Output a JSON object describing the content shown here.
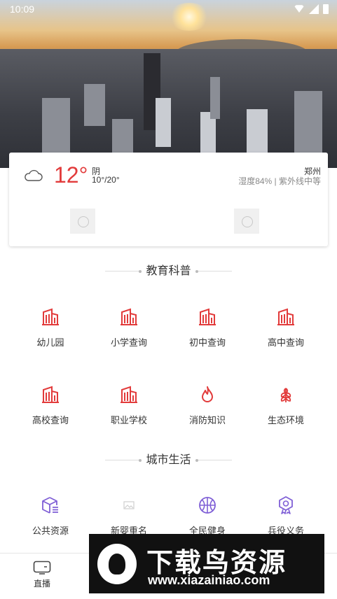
{
  "status_bar": {
    "time": "10:09"
  },
  "weather": {
    "temperature": "12°",
    "condition": "阴",
    "range": "10°/20°",
    "city": "郑州",
    "details": "湿度84% | 紫外线中等",
    "icon": "cloud-icon"
  },
  "sections": {
    "education": {
      "title": "教育科普",
      "items": [
        {
          "label": "幼儿园",
          "icon": "building-icon"
        },
        {
          "label": "小学查询",
          "icon": "building-icon"
        },
        {
          "label": "初中查询",
          "icon": "building-icon"
        },
        {
          "label": "高中查询",
          "icon": "building-icon"
        },
        {
          "label": "高校查询",
          "icon": "building-icon"
        },
        {
          "label": "职业学校",
          "icon": "building-icon"
        },
        {
          "label": "消防知识",
          "icon": "flame-icon"
        },
        {
          "label": "生态环境",
          "icon": "leaf-icon"
        }
      ]
    },
    "city_life": {
      "title": "城市生活",
      "items": [
        {
          "label": "公共资源",
          "icon": "cube-icon"
        },
        {
          "label": "新婴重名",
          "icon": "image-placeholder-icon"
        },
        {
          "label": "全民健身",
          "icon": "basketball-icon"
        },
        {
          "label": "兵役义务",
          "icon": "medal-icon"
        }
      ]
    }
  },
  "bottom_nav": {
    "live_label": "直播"
  },
  "watermark": {
    "brand": "下载鸟资源",
    "url": "www.xiazainiao.com"
  },
  "colors": {
    "accent": "#e23b3b",
    "purple": "#7f5fd6"
  }
}
